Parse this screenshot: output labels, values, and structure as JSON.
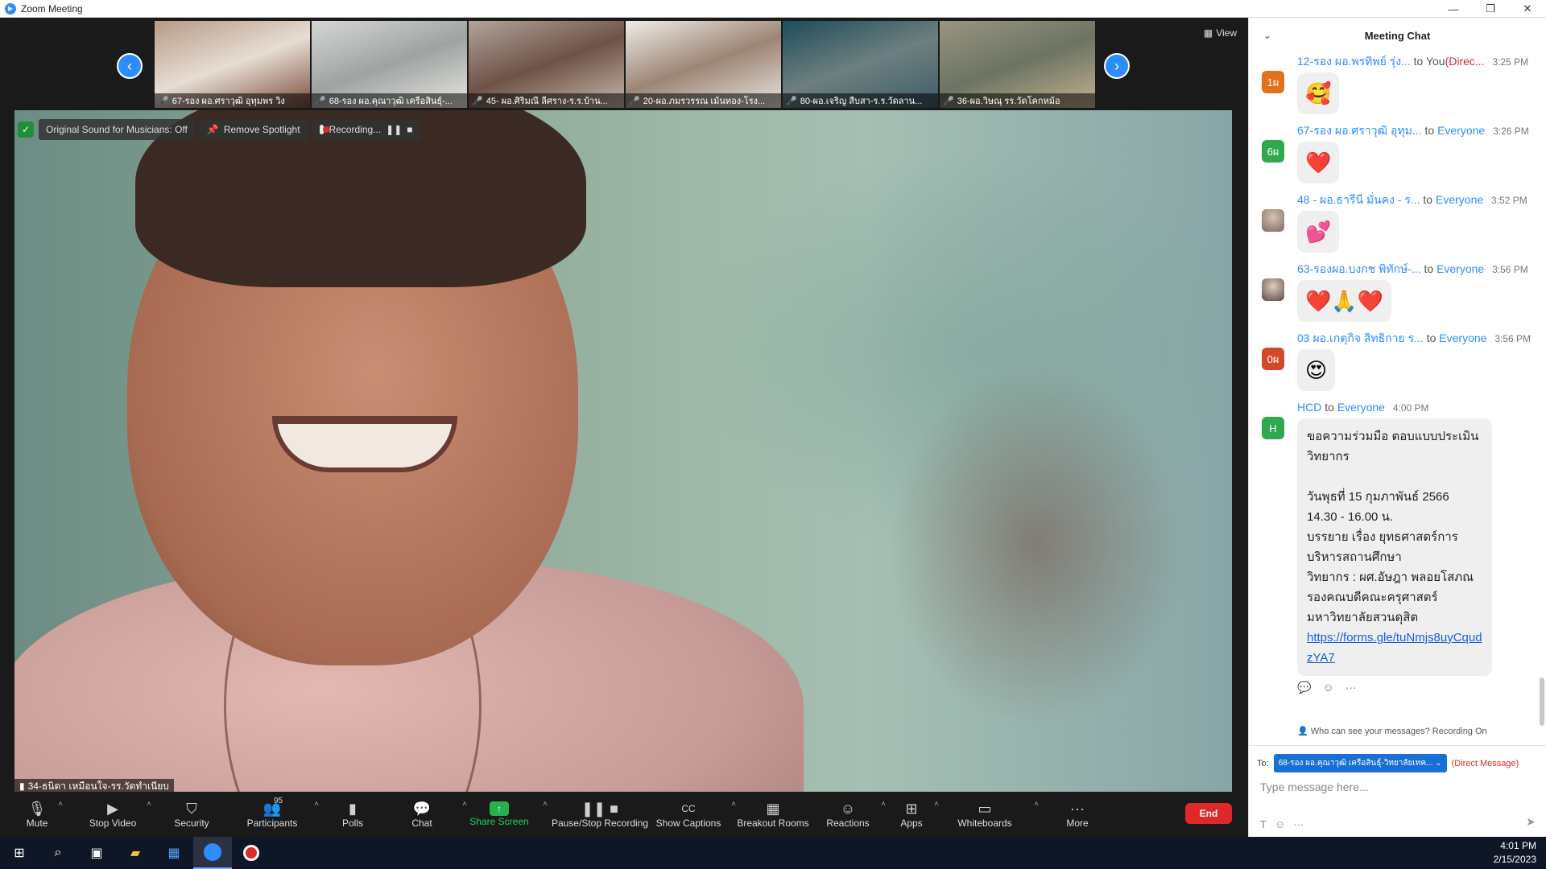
{
  "window": {
    "title": "Zoom Meeting"
  },
  "strip": {
    "thumbnails": [
      {
        "name": "67-รอง ผอ.ศราวุฒิ อุทุมพร วิง"
      },
      {
        "name": "68-รอง ผอ.คุณาวุฒิ เครือสินธุ์-..."
      },
      {
        "name": "45- ผอ.ศิริมณี ลีศราง-ร.ร.บ้าน..."
      },
      {
        "name": "20-ผอ.ภมรวรรณ เม้นทอง-โรง..."
      },
      {
        "name": "80-ผอ.เจริญ สืบสา-ร.ร.วัดลาน..."
      },
      {
        "name": "36-ผอ.วิษณุ รร.วัดโคกหม้อ"
      }
    ],
    "view_label": "View"
  },
  "top_toolbar": {
    "original_sound": "Original Sound for Musicians: Off",
    "remove_spotlight": "Remove Spotlight",
    "recording": "Recording..."
  },
  "speaker": {
    "name": "34-ธนิดา เหมือนใจ-รร.วัดทำเนียบ"
  },
  "toolbar": {
    "mute": "Mute",
    "stop_video": "Stop Video",
    "security": "Security",
    "participants": "Participants",
    "participants_count": "95",
    "polls": "Polls",
    "chat": "Chat",
    "share_screen": "Share Screen",
    "pause_stop_recording": "Pause/Stop Recording",
    "show_captions": "Show Captions",
    "breakout_rooms": "Breakout Rooms",
    "reactions": "Reactions",
    "apps": "Apps",
    "whiteboards": "Whiteboards",
    "more": "More",
    "end": "End"
  },
  "chat": {
    "title": "Meeting Chat",
    "messages": [
      {
        "avatar": "1ผ",
        "avatar_color": "#e1711f",
        "sender": "12-รอง ผอ.พรทิพย์ รุ่ง...",
        "to": "to",
        "recipient": "You",
        "direct": "(Direc...",
        "time": "3:25 PM",
        "content": "🥰"
      },
      {
        "avatar": "6ผ",
        "avatar_color": "#2fa84f",
        "sender": "67-รอง ผอ.ศราวุฒิ อุทุม...",
        "to": "to",
        "recipient": "Everyone",
        "time": "3:26 PM",
        "content": "❤️"
      },
      {
        "avatar": "",
        "avatar_color": "#9b8e86",
        "sender": "48 - ผอ.ธารีนี มั่นคง - ร...",
        "to": "to",
        "recipient": "Everyone",
        "time": "3:52 PM",
        "content": "💕"
      },
      {
        "avatar": "",
        "avatar_color": "#8a7a72",
        "sender": "63-รองผอ.บงกช พิทักษ์-...",
        "to": "to",
        "recipient": "Everyone",
        "time": "3:56 PM",
        "content": "❤️🙏❤️"
      },
      {
        "avatar": "0ผ",
        "avatar_color": "#d04a2a",
        "sender": "03 ผอ.เกตุกิจ สิทธิกาย ร...",
        "to": "to",
        "recipient": "Everyone",
        "time": "3:56 PM",
        "content": "😍"
      },
      {
        "avatar": "H",
        "avatar_color": "#2fa84f",
        "sender": "HCD",
        "to": "to",
        "recipient": "Everyone",
        "time": "4:00 PM",
        "text": "ขอความร่วมมือ ตอบแบบประเมินวิทยากร\n\nวันพุธที่ 15 กุมภาพันธ์ 2566\n14.30 - 16.00 น.\nบรรยาย เรื่อง  ยุทธศาสตร์การบริหารสถานศึกษา\nวิทยากร :   ผศ.อัษฎา  พลอยโสภณ  รองคณบดีคณะครุศาสตร์ มหาวิทยาลัยสวนดุสิต",
        "link": "https://forms.gle/tuNmjs8uyCqudzYA7"
      }
    ],
    "privacy_note": "Who can see your messages? Recording On",
    "to_label": "To:",
    "to_recipient": "68-รอง ผอ.คุณาวุฒิ เครือสินธุ์-วิทยาลัยเทค...",
    "direct_message": "(Direct Message)",
    "input_placeholder": "Type message here..."
  },
  "taskbar": {
    "time": "4:01 PM",
    "date": "2/15/2023"
  }
}
